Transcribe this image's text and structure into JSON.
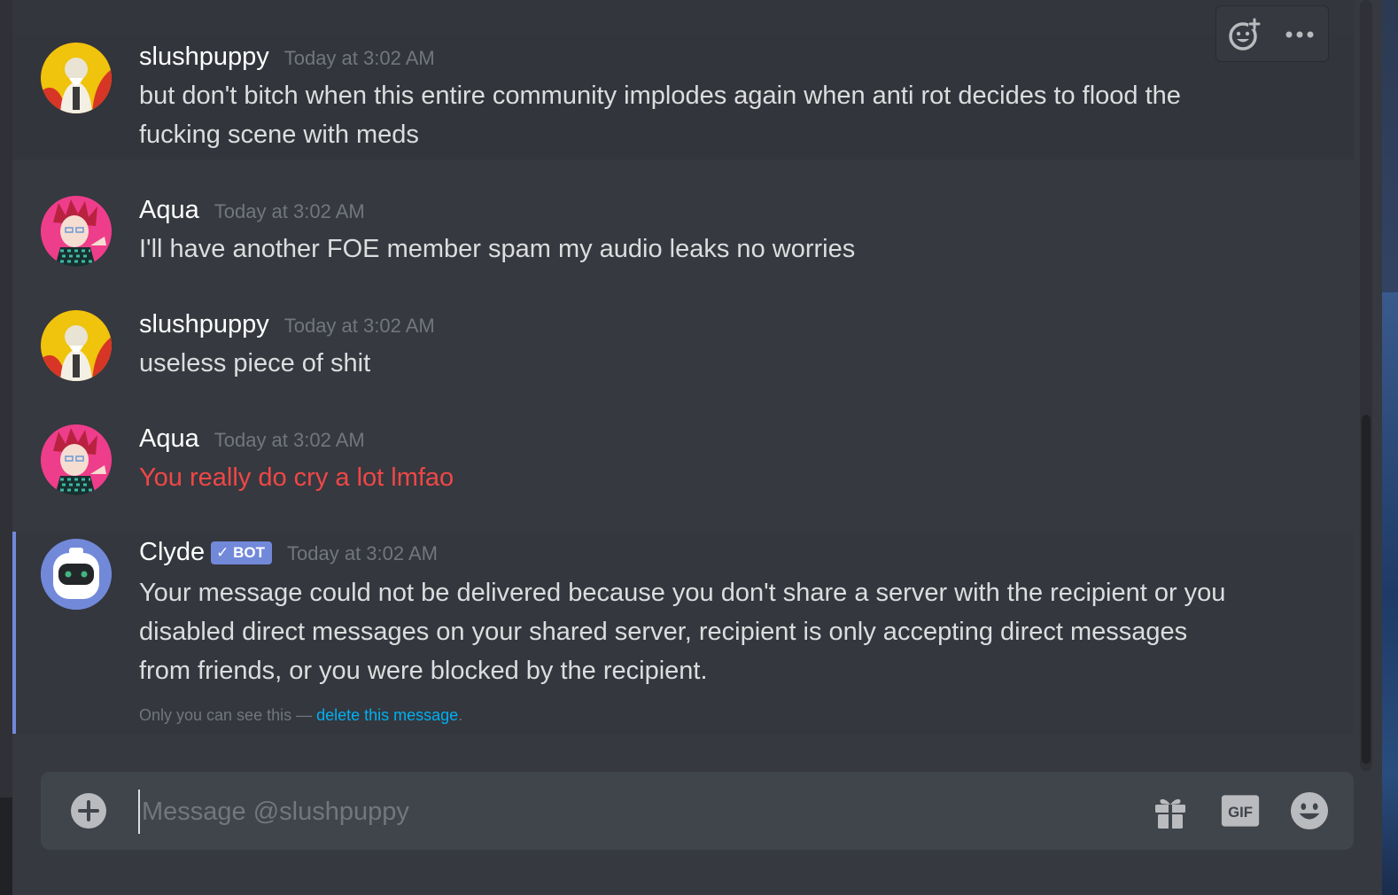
{
  "messages": [
    {
      "author": "slushpuppy",
      "timestamp": "Today at 3:02 AM",
      "lines": [
        "but don't bitch when this entire community implodes again when anti rot decides to flood the",
        "fucking scene with meds"
      ],
      "avatar": "slushpuppy-avatar"
    },
    {
      "author": "Aqua",
      "timestamp": "Today at 3:02 AM",
      "lines": [
        "I'll have another FOE member spam my audio leaks no worries"
      ],
      "avatar": "aqua-avatar"
    },
    {
      "author": "slushpuppy",
      "timestamp": "Today at 3:02 AM",
      "lines": [
        "useless piece of shit"
      ],
      "avatar": "slushpuppy-avatar"
    },
    {
      "author": "Aqua",
      "timestamp": "Today at 3:02 AM",
      "lines": [
        "You really do cry a lot lmfao"
      ],
      "text_color": "#f04747",
      "avatar": "aqua-avatar"
    },
    {
      "author": "Clyde",
      "badge": "✓ BOT",
      "timestamp": "Today at 3:02 AM",
      "lines": [
        "Your message could not be delivered because you don't share a server with the recipient or you",
        "disabled direct messages on your shared server, recipient is only accepting direct messages",
        "from friends, or you were blocked by the recipient."
      ],
      "note_prefix": "Only you can see this — ",
      "note_link": "delete this message",
      "note_suffix": ".",
      "avatar": "clyde-bot-avatar"
    }
  ],
  "toolbar": {
    "add_reaction_icon": "add-reaction-icon",
    "more_icon": "more-options-icon"
  },
  "composer": {
    "placeholder": "Message @slushpuppy",
    "value": "",
    "gif_label": "GIF"
  },
  "colors": {
    "background": "#36393f",
    "accent": "#7289da",
    "link": "#00b0f4",
    "error_text": "#f04747"
  }
}
